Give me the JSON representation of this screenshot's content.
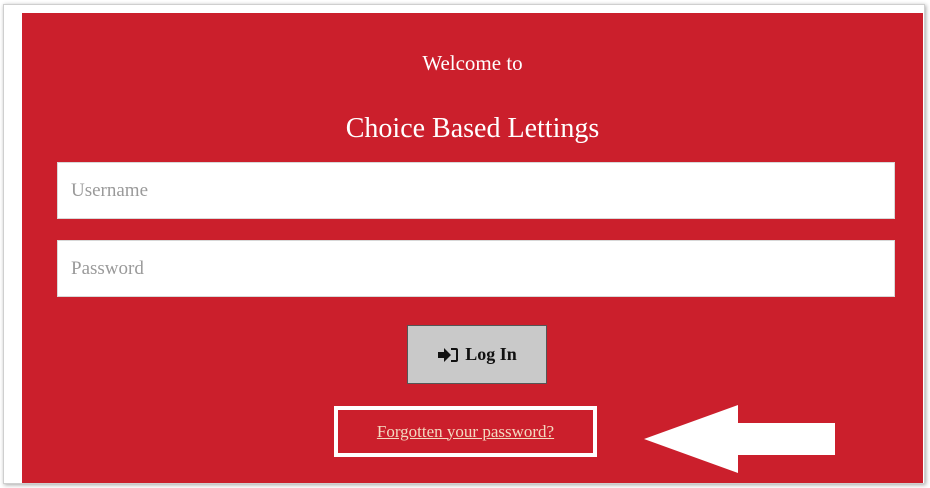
{
  "login": {
    "welcome": "Welcome to",
    "site_title": "Choice Based Lettings",
    "username_placeholder": "Username",
    "password_placeholder": "Password",
    "login_button_label": "Log In",
    "login_icon": "sign-in-icon",
    "forgot_password_link": "Forgotten your password?"
  },
  "annotation": {
    "arrow_icon": "left-arrow-icon",
    "highlight_color": "#ffffff"
  },
  "colors": {
    "panel_background": "#cb1f2c",
    "button_background": "#c9c9c9",
    "link_color": "#f3d9c0"
  }
}
